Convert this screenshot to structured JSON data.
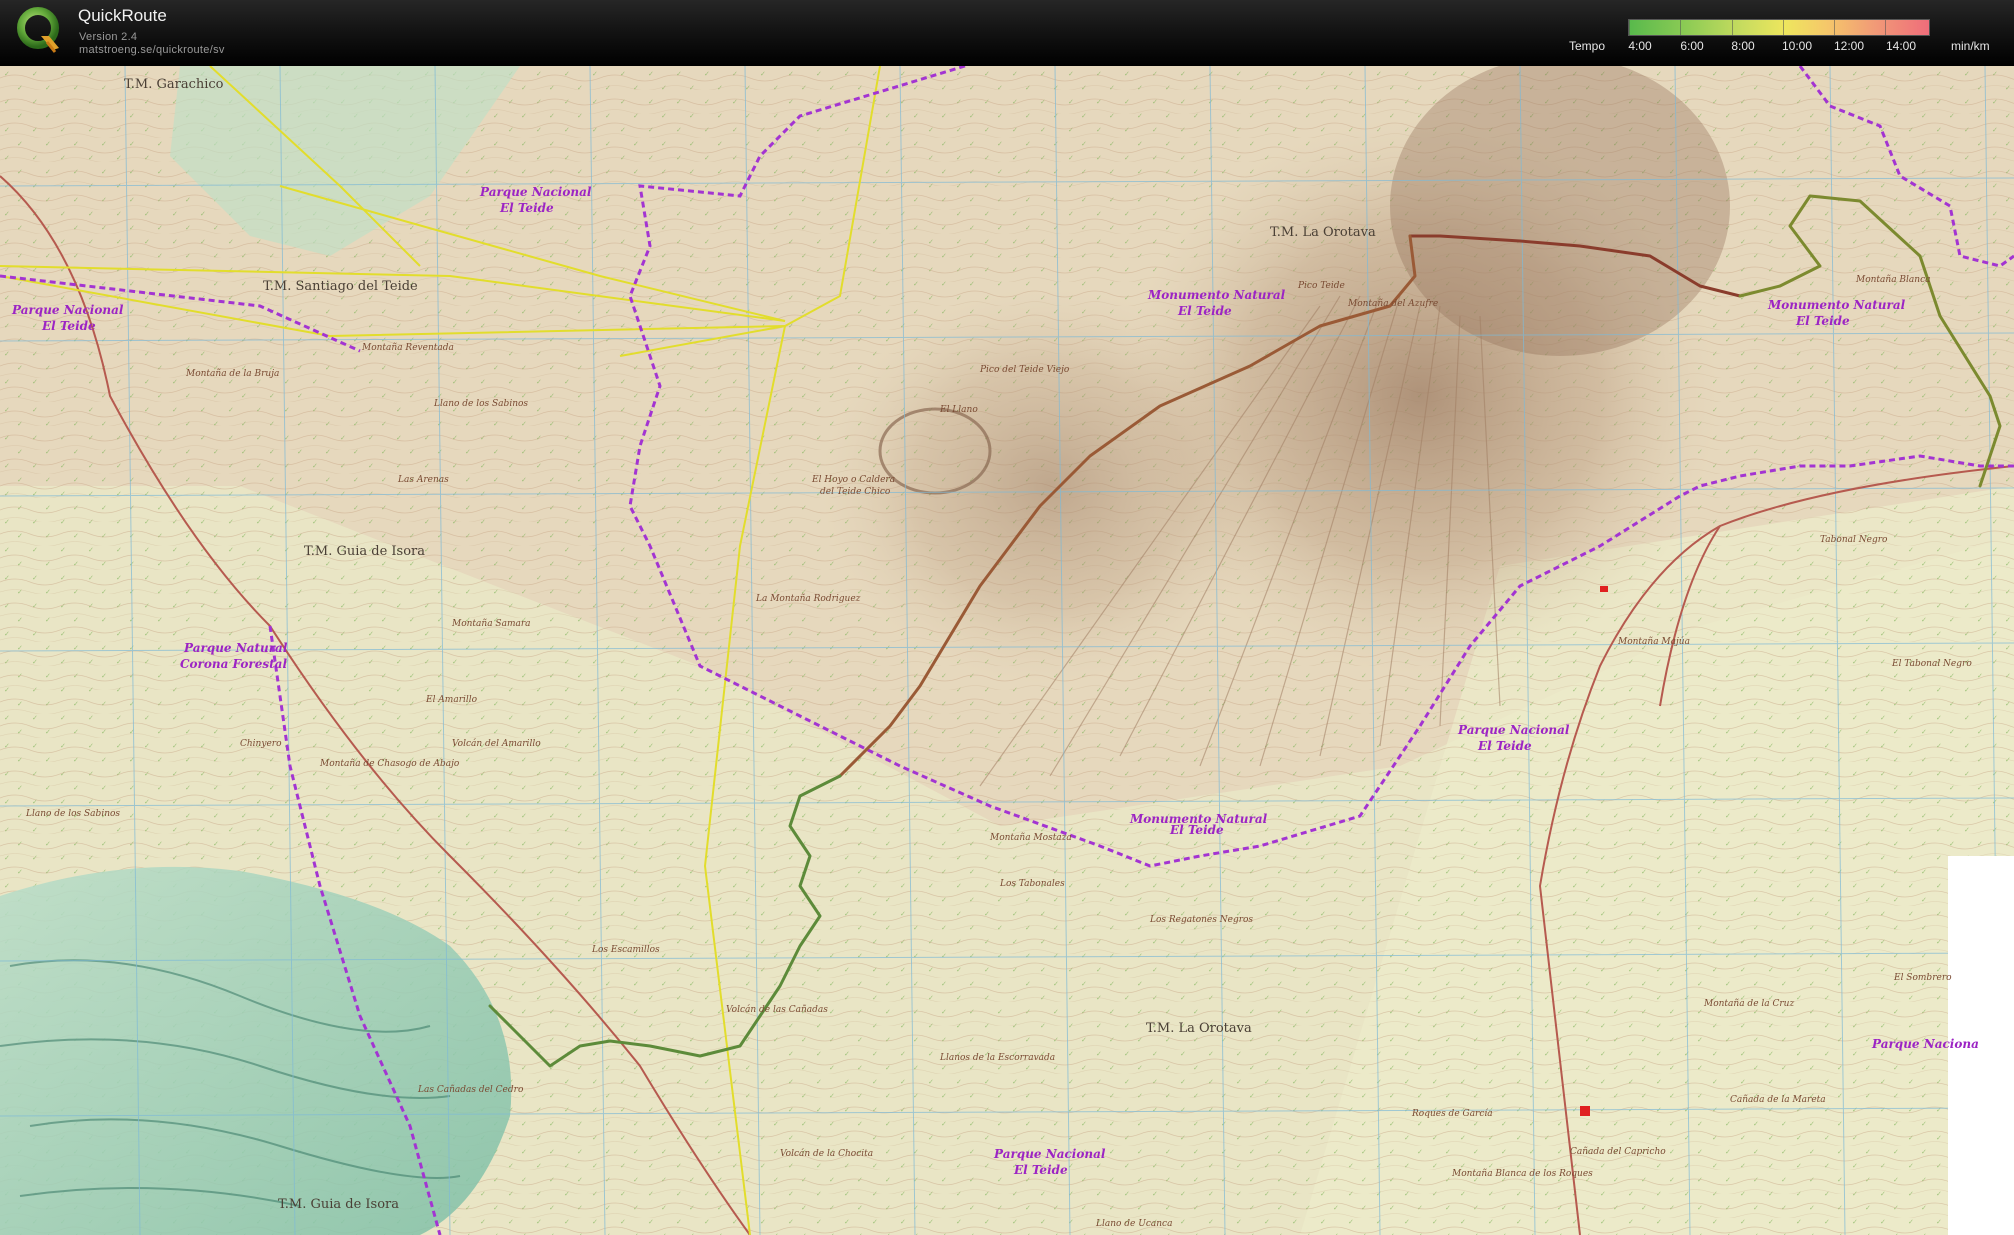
{
  "app": {
    "name": "QuickRoute",
    "version": "Version 2.4",
    "url": "matstroeng.se/quickroute/sv",
    "logo_letter": "Q"
  },
  "legend": {
    "label": "Tempo",
    "unit": "min/km",
    "ticks": [
      "4:00",
      "6:00",
      "8:00",
      "10:00",
      "12:00",
      "14:00"
    ],
    "gradient_colors": [
      "#58b94c",
      "#8fcc55",
      "#c8dc5f",
      "#eee65e",
      "#f5c76a",
      "#f19a77",
      "#ef6d7a"
    ]
  },
  "map": {
    "colors": {
      "background": "#e8dcc4",
      "park_boundary": "#a334d2",
      "power_line": "#e2dd2c",
      "road": "#b65a4f",
      "grid": "#7fbad6",
      "route_fast": "#5d8b3a",
      "route_slow": "#8a3c2c"
    },
    "municipality_labels": [
      "T.M. Garachico",
      "T.M. Santiago del Teide",
      "T.M. Guia de Isora",
      "T.M. La Orotava",
      "T.M. La Orotava",
      "T.M. Guia de Isora"
    ],
    "park_labels": [
      "Parque Nacional",
      "El Teide",
      "Parque Nacional",
      "El Teide",
      "Monumento Natural",
      "El Teide",
      "Monumento Natural",
      "El Teide",
      "Parque Natural",
      "Corona Forestal",
      "Monumento Natural",
      "El Teide",
      "Parque Nacional",
      "El Teide",
      "Parque Nacional",
      "El Teide",
      "Parque Naciona"
    ],
    "place_labels": [
      "Pico Teide",
      "Montaña del Azufre",
      "El Llano",
      "Pico del Teide Viejo",
      "El Hoyo o Caldera",
      "del Teide Chico",
      "La Montaña Rodriguez",
      "Montaña Reventada",
      "Montaña de la Bruja",
      "Llano de los Sabinos",
      "Montaña Samara",
      "El Amarillo",
      "Volcán del Amarillo",
      "Chinyero",
      "Montaña de Chasogo de Abajo",
      "Llano de los Sabinos",
      "Las Cañadas del Cedro",
      "Volcán de las Cañadas",
      "Los Escamillos",
      "Llanos de la Escorravada",
      "Los Regatones Negros",
      "Montaña Mostaza",
      "Montaña Blanca",
      "Montaña de la Cruz",
      "Cañada del Capricho",
      "Cañada de la Mareta",
      "El Sombrero",
      "Montaña Blanca de los Roques",
      "Volcán de la Chocita",
      "Roques de García",
      "Llano de Ucanca",
      "Los Tabonales",
      "El Tabonal Negro",
      "Tabonal Negro",
      "Montaña Majúa",
      "Las Arenas"
    ]
  }
}
